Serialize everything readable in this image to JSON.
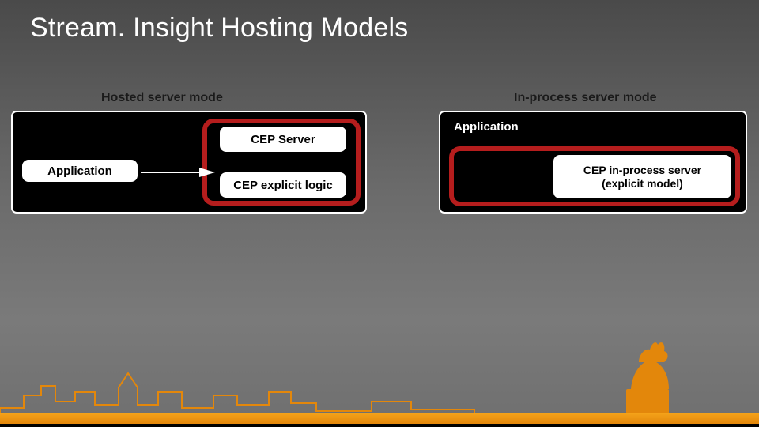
{
  "title": "Stream. Insight Hosting Models",
  "hosted_label": "Hosted server mode",
  "inproc_label": "In-process server mode",
  "left": {
    "application": "Application",
    "cep_server": "CEP Server",
    "cep_logic": "CEP explicit logic"
  },
  "right": {
    "application": "Application",
    "cep_inproc": "CEP in-process server (explicit model)"
  },
  "colors": {
    "accent_red": "#b51d1d",
    "accent_orange": "#e3870b"
  }
}
